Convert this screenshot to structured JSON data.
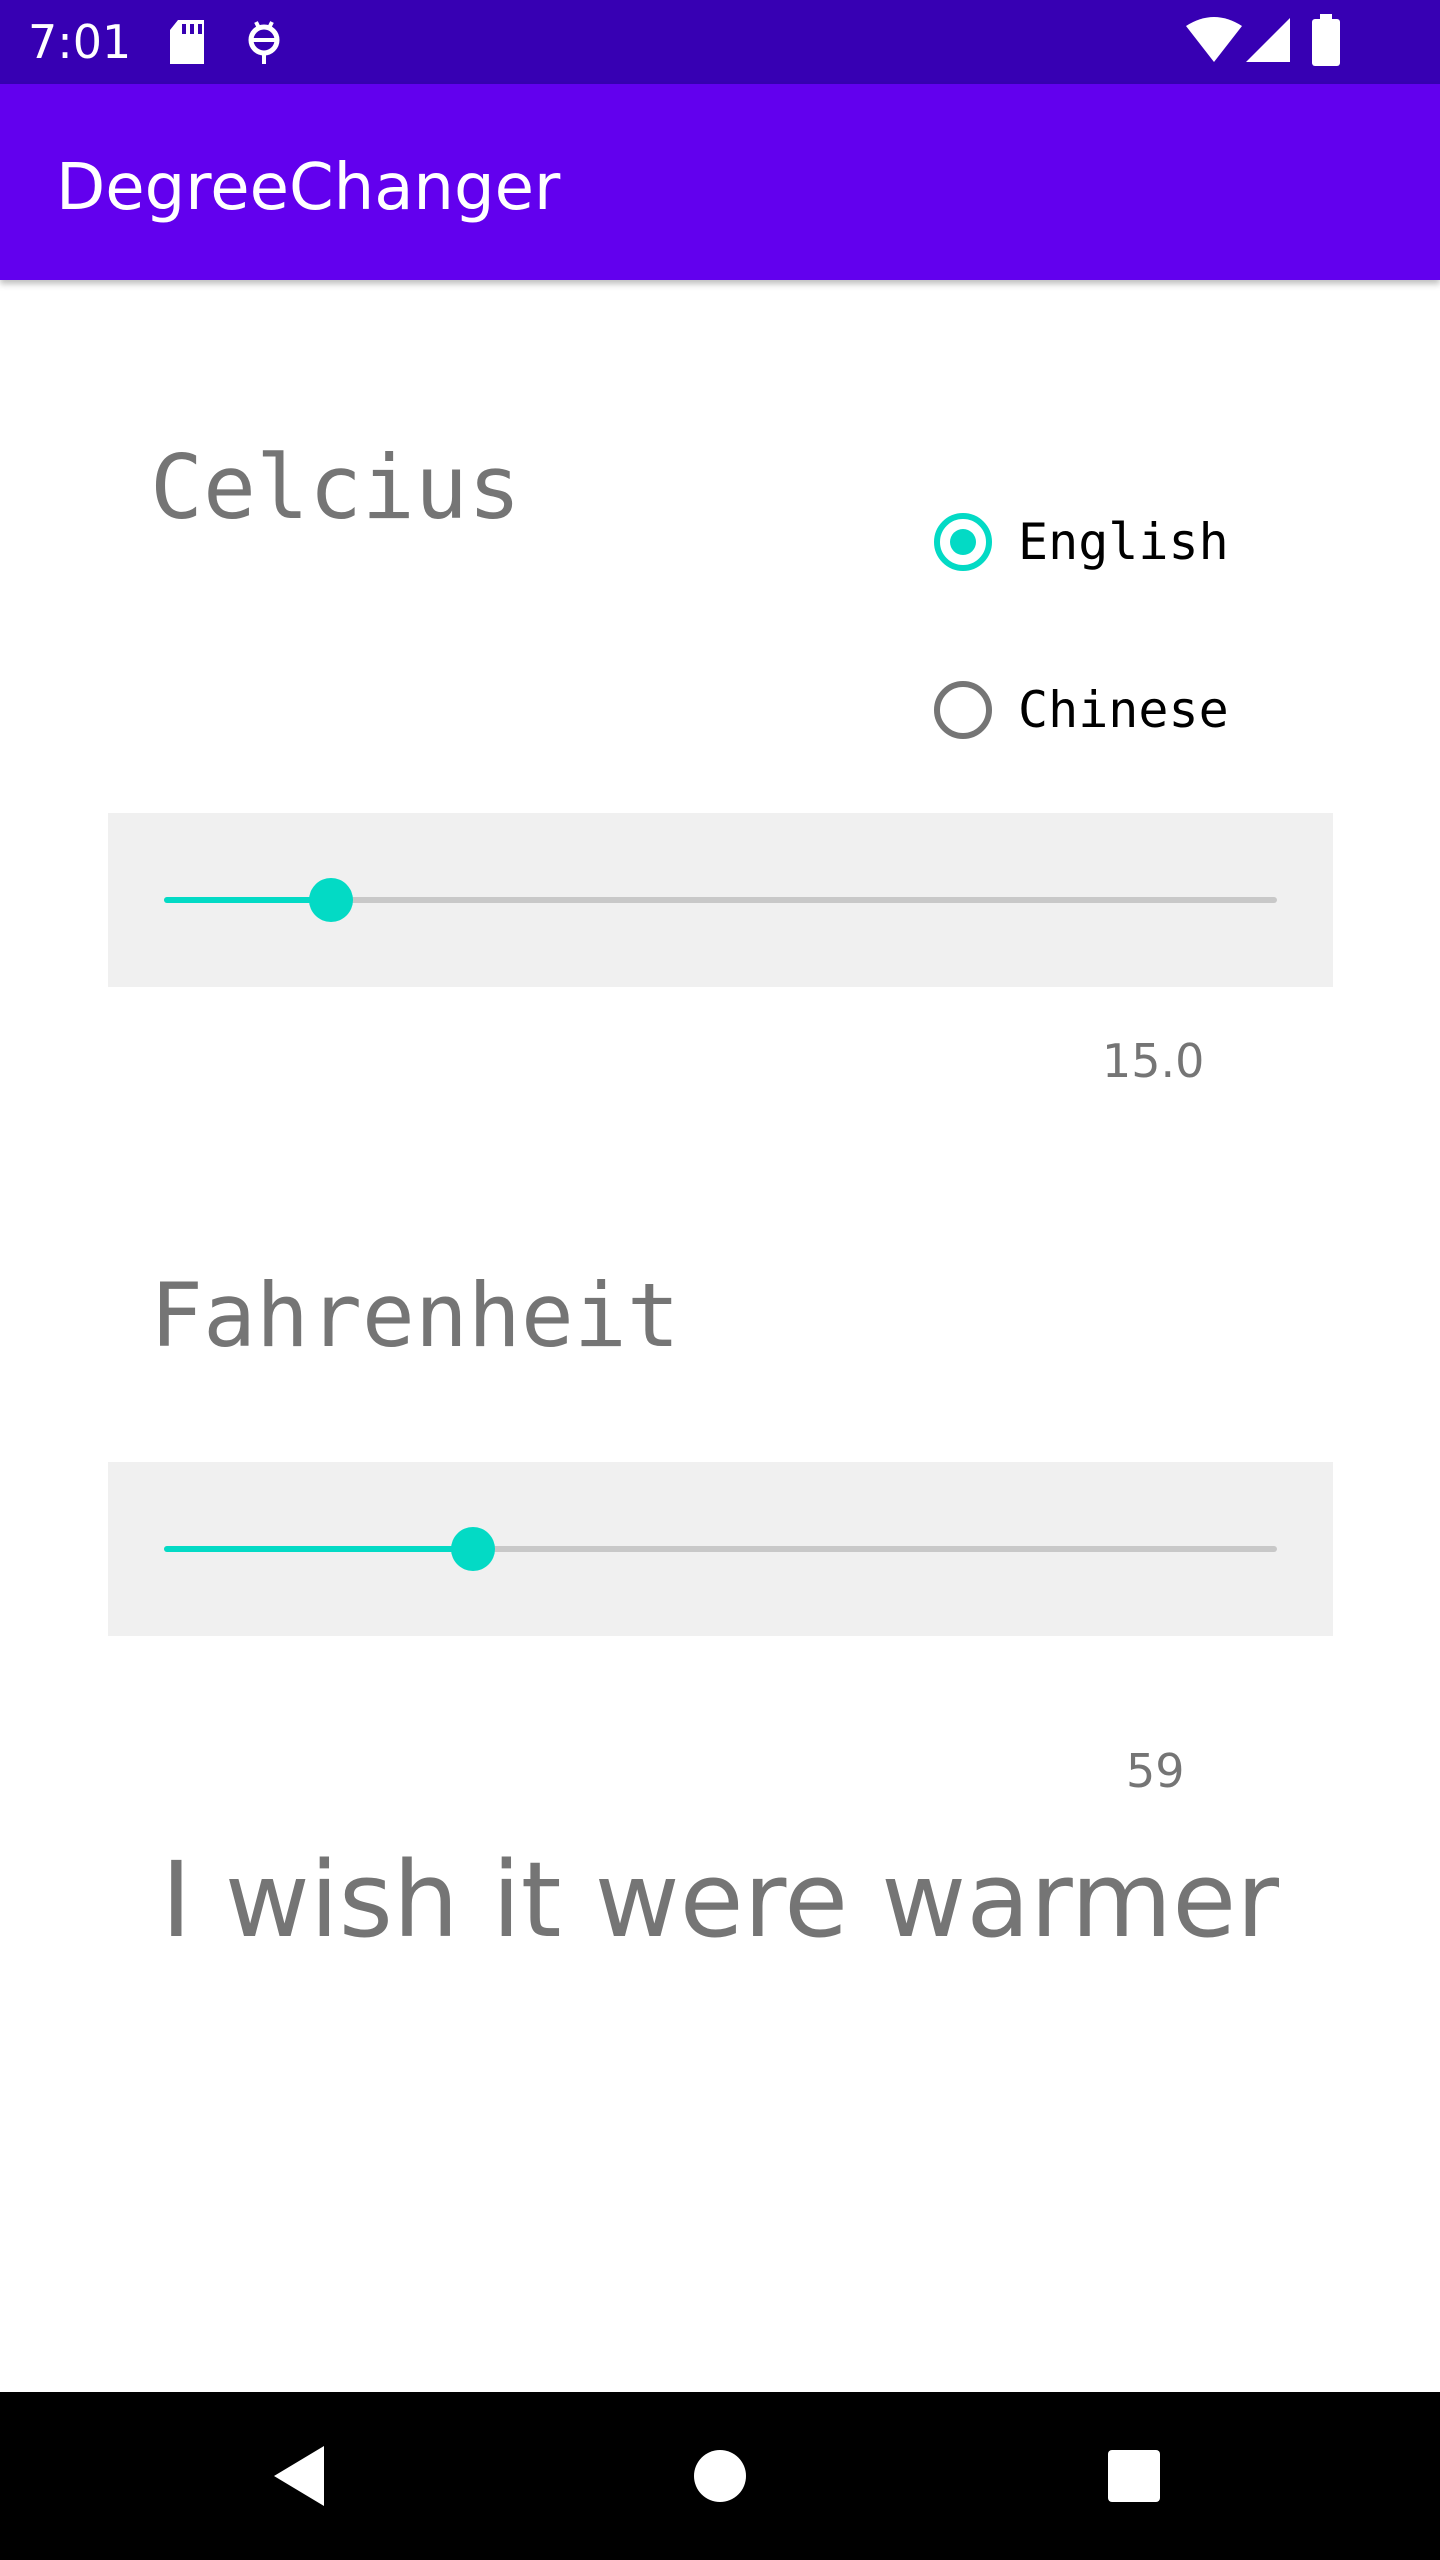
{
  "status_bar": {
    "time": "7:01",
    "icons": [
      "sd-card-icon",
      "android-debug-icon",
      "wifi-icon",
      "cell-signal-icon",
      "battery-icon"
    ]
  },
  "app_bar": {
    "title": "DegreeChanger"
  },
  "celsius": {
    "title": "Celcius",
    "value_text": "15.0",
    "slider_fraction": 0.15
  },
  "language": {
    "options": [
      {
        "label": "English",
        "selected": true
      },
      {
        "label": "Chinese",
        "selected": false
      }
    ]
  },
  "fahrenheit": {
    "title": "Fahrenheit",
    "value_text": "59",
    "slider_fraction": 0.278
  },
  "message": "I wish it were warmer",
  "colors": {
    "status_bar": "#3700b3",
    "app_bar": "#6200ee",
    "accent": "#03dac5"
  },
  "nav_bar": {
    "icons": [
      "back-icon",
      "home-icon",
      "recents-icon"
    ]
  }
}
